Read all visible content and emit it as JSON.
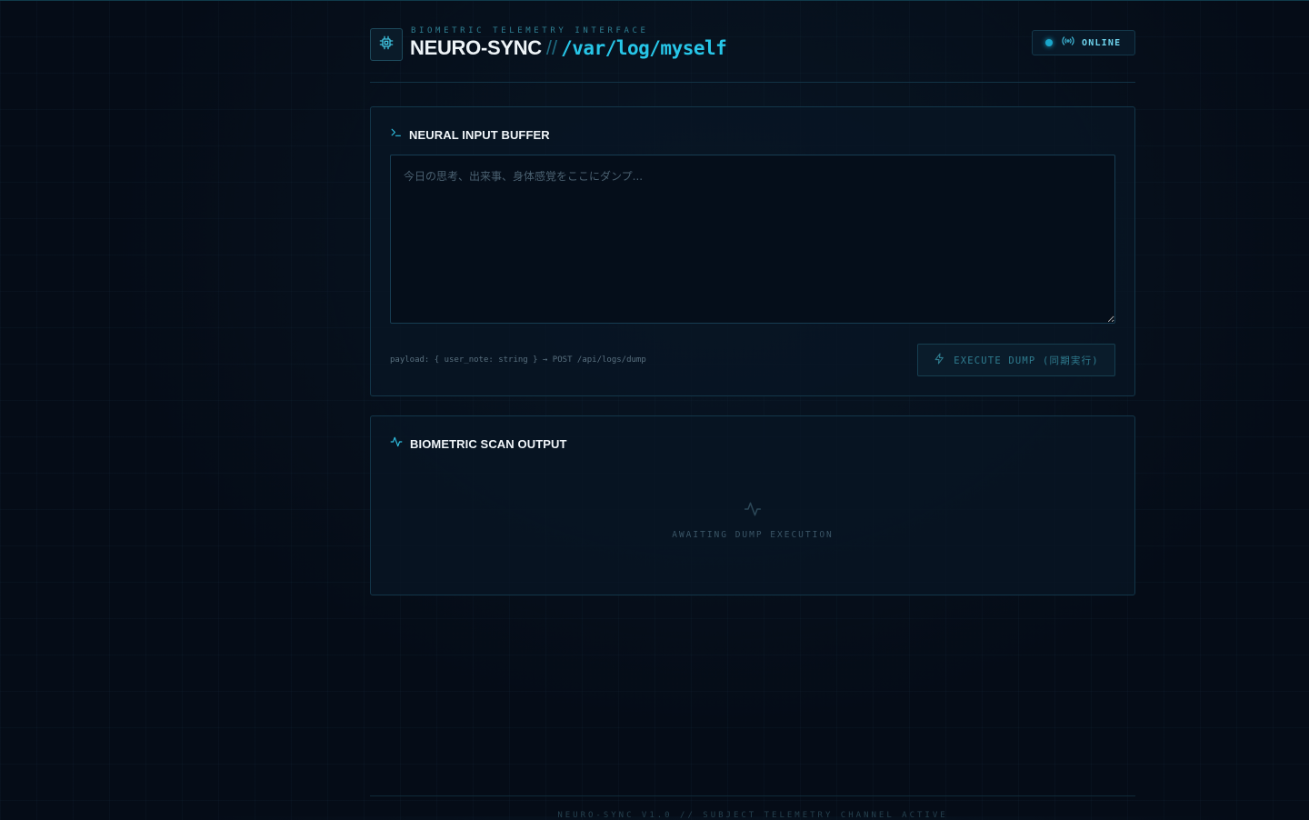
{
  "colors": {
    "accent": "#27c6e8",
    "background": "#050c17",
    "status_online": "#1aa7cc",
    "panel_border": "#133649"
  },
  "header": {
    "eyebrow": "BIOMETRIC TELEMETRY INTERFACE",
    "title": "NEURO-SYNC",
    "separator": "//",
    "path": "/var/log/myself",
    "logo_icon": "cpu-chip-icon",
    "status": {
      "icon": "radio-broadcast-icon",
      "label": "ONLINE"
    }
  },
  "input_panel": {
    "icon": "terminal-prompt-icon",
    "title": "NEURAL INPUT BUFFER",
    "textarea": {
      "value": "",
      "placeholder": "今日の思考、出来事、身体感覚をここにダンプ..."
    },
    "payload_hint": "payload: { user_note: string } → POST /api/logs/dump",
    "execute_button": {
      "icon": "lightning-bolt-icon",
      "label": "EXECUTE DUMP (同期実行)"
    }
  },
  "output_panel": {
    "icon": "activity-pulse-icon",
    "title": "BIOMETRIC SCAN OUTPUT",
    "empty_icon": "activity-pulse-icon",
    "empty_text": "AWAITING DUMP EXECUTION"
  },
  "footer": {
    "text": "NEURO-SYNC V1.0 // SUBJECT TELEMETRY CHANNEL ACTIVE"
  }
}
